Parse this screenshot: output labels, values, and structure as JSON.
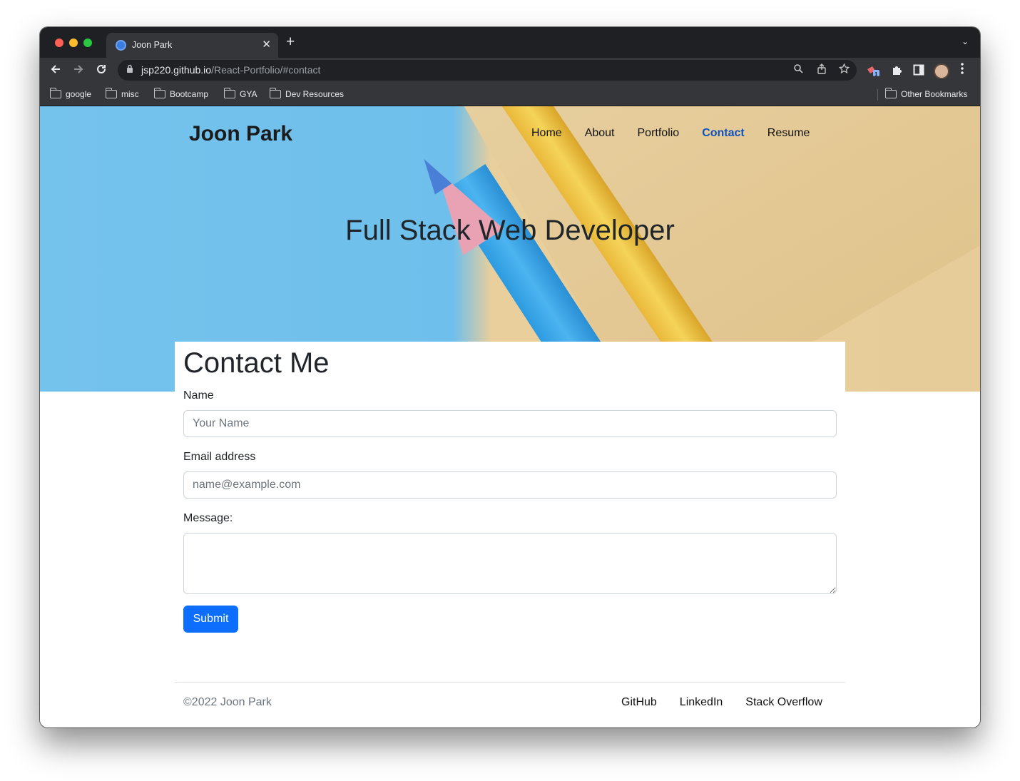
{
  "browser": {
    "tab_title": "Joon Park",
    "tab_close": "✕",
    "new_tab": "+",
    "tab_menu": "⌄",
    "url_host": "jsp220.github.io",
    "url_path": "/React-Portfolio/#contact",
    "extension_badge": "1",
    "bookmarks": [
      "google",
      "misc",
      "Bootcamp",
      "GYA",
      "Dev Resources"
    ],
    "other_bookmarks": "Other Bookmarks"
  },
  "site": {
    "brand": "Joon Park",
    "nav": [
      "Home",
      "About",
      "Portfolio",
      "Contact",
      "Resume"
    ],
    "active_nav": "Contact",
    "hero_title": "Full Stack Web Developer"
  },
  "contact": {
    "heading": "Contact Me",
    "name_label": "Name",
    "name_placeholder": "Your Name",
    "email_label": "Email address",
    "email_placeholder": "name@example.com",
    "message_label": "Message:",
    "message_value": "",
    "submit_label": "Submit"
  },
  "footer": {
    "copyright": "©2022 Joon Park",
    "links": [
      "GitHub",
      "LinkedIn",
      "Stack Overflow"
    ]
  },
  "colors": {
    "accent": "#0d6efd",
    "active_nav": "#0d52bf",
    "hero_blue": "#74c3ed",
    "hero_tan": "#e8cf9c"
  },
  "icons": {
    "back": "arrow-left-icon",
    "forward": "arrow-right-icon",
    "reload": "reload-icon",
    "lock": "lock-icon",
    "search": "search-icon",
    "share": "share-icon",
    "star": "star-icon",
    "extensions": "puzzle-icon",
    "sidebar": "side-panel-icon",
    "menu": "kebab-menu-icon",
    "folder": "folder-icon"
  }
}
